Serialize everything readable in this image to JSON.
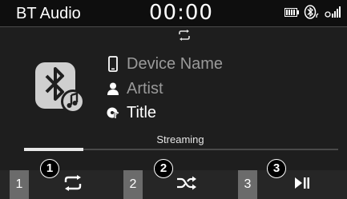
{
  "status_bar": {
    "app_title": "BT Audio",
    "clock": "00:00",
    "icons": [
      "battery-icon",
      "bluetooth-connection-icon",
      "signal-icon"
    ]
  },
  "now_playing": {
    "repeat_indicator_icon": "repeat-icon",
    "album_art_icons": [
      "bluetooth-icon",
      "music-note-icon"
    ],
    "device_name": "Device Name",
    "artist": "Artist",
    "title": "Title",
    "device_icon": "phone-icon",
    "artist_icon": "person-icon",
    "title_icon": "song-title-icon",
    "streaming_label": "Streaming",
    "progress_fraction": 0.19
  },
  "controls": [
    {
      "number": "1",
      "callout": "1",
      "icon": "repeat-icon"
    },
    {
      "number": "2",
      "callout": "2",
      "icon": "shuffle-icon"
    },
    {
      "number": "3",
      "callout": "3",
      "icon": "play-pause-icon"
    }
  ],
  "colors": {
    "background": "#1e1e1e",
    "status_bar": "#0e0e0e",
    "dim_text": "#9a9a9a",
    "number_box": "#6b6b6b"
  }
}
